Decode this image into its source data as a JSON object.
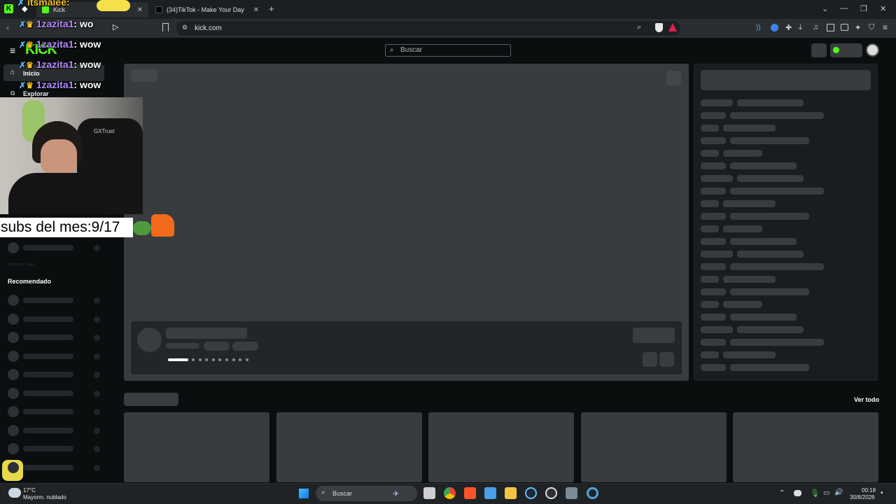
{
  "browser": {
    "tabs": [
      {
        "label": "Kick",
        "active": true
      },
      {
        "label": "(34)TikTok - Make Your Day",
        "active": false
      }
    ],
    "new_tab": "+",
    "url": "kick.com"
  },
  "kick": {
    "logo": "KICK",
    "search_placeholder": "Buscar",
    "nav": [
      {
        "label": "Inicio",
        "icon": "home-icon"
      },
      {
        "label": "Explorar",
        "icon": "compass-icon"
      }
    ],
    "sidebar_dim_label": "Mostrar más",
    "recommended_heading": "Recomendado",
    "see_all": "Ver todo"
  },
  "overlay": {
    "top_line_user": "itsmalee:",
    "chat": [
      {
        "user": "1zazita1",
        "message": "wo"
      },
      {
        "user": "1zazita1",
        "message": "wow"
      },
      {
        "user": "1zazita1",
        "message": "wow"
      },
      {
        "user": "1zazita1",
        "message": "wow"
      }
    ],
    "cam_brand": "GXTrust",
    "subs_label": "subs del mes:9/17"
  },
  "taskbar": {
    "weather_temp": "17°C",
    "weather_desc": "Mayorm. nublado",
    "search_label": "Buscar",
    "time": "00:18",
    "date": "30/8/2026"
  },
  "colors": {
    "kick_green": "#53fc18",
    "chat_user": "#b38cff",
    "skeleton": "#393c3f"
  }
}
